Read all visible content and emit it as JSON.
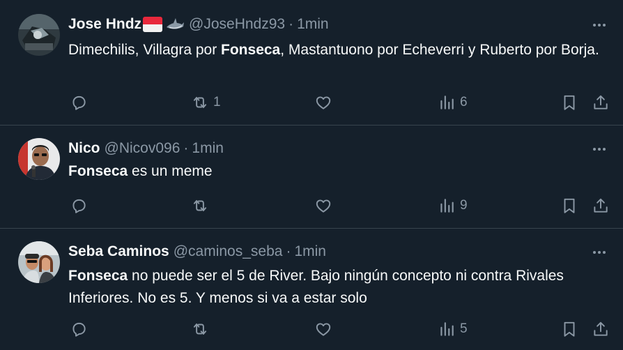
{
  "tweets": [
    {
      "display_name": "Jose Hndz",
      "handle": "@JoseHndz93",
      "separator": "·",
      "time": "1min",
      "text_parts": [
        "Dimechilis, Villagra por ",
        "Fonseca",
        ", Mastantuono por Echeverri y Ruberto por Borja."
      ],
      "retweets": "1",
      "views": "6",
      "avatar_icon": "photo-avatar",
      "emojis": [
        "indonesia-flag-icon",
        "shark-icon"
      ]
    },
    {
      "display_name": "Nico",
      "handle": "@Nicov096",
      "separator": "·",
      "time": "1min",
      "text_parts": [
        "Fonseca",
        " es un meme"
      ],
      "retweets": "",
      "views": "9",
      "avatar_icon": "photo-avatar"
    },
    {
      "display_name": "Seba Caminos",
      "handle": "@caminos_seba",
      "separator": "·",
      "time": "1min",
      "text_parts": [
        "Fonseca",
        " no puede ser el 5 de River. Bajo ningún concepto ni contra Rivales Inferiores. No es 5. Y menos si va a estar solo"
      ],
      "retweets": "",
      "views": "5",
      "avatar_icon": "photo-avatar"
    }
  ],
  "colors": {
    "background": "#15202b",
    "divider": "#38444d",
    "primary_text": "#f7f9f9",
    "secondary_text": "#8b98a5"
  }
}
